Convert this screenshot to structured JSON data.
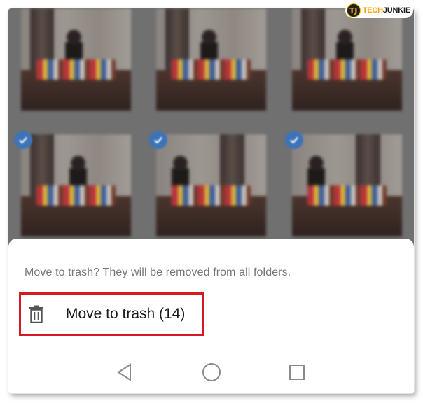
{
  "watermark": {
    "badge_letters": "TJ",
    "brand_part1": "TECH",
    "brand_part2": "JUNKIE"
  },
  "gallery": {
    "rows": [
      {
        "selected": [
          false,
          false,
          false
        ]
      },
      {
        "selected": [
          true,
          true,
          true
        ]
      }
    ],
    "check_color": "#3d73b8"
  },
  "bottom_sheet": {
    "message": "Move to trash? They will be removed from all folders.",
    "action": {
      "icon": "trash-icon",
      "label": "Move to trash (14)",
      "highlight_color": "#d71920"
    }
  },
  "navigation_bar": {
    "buttons": [
      "back-icon",
      "home-icon",
      "recents-icon"
    ]
  }
}
